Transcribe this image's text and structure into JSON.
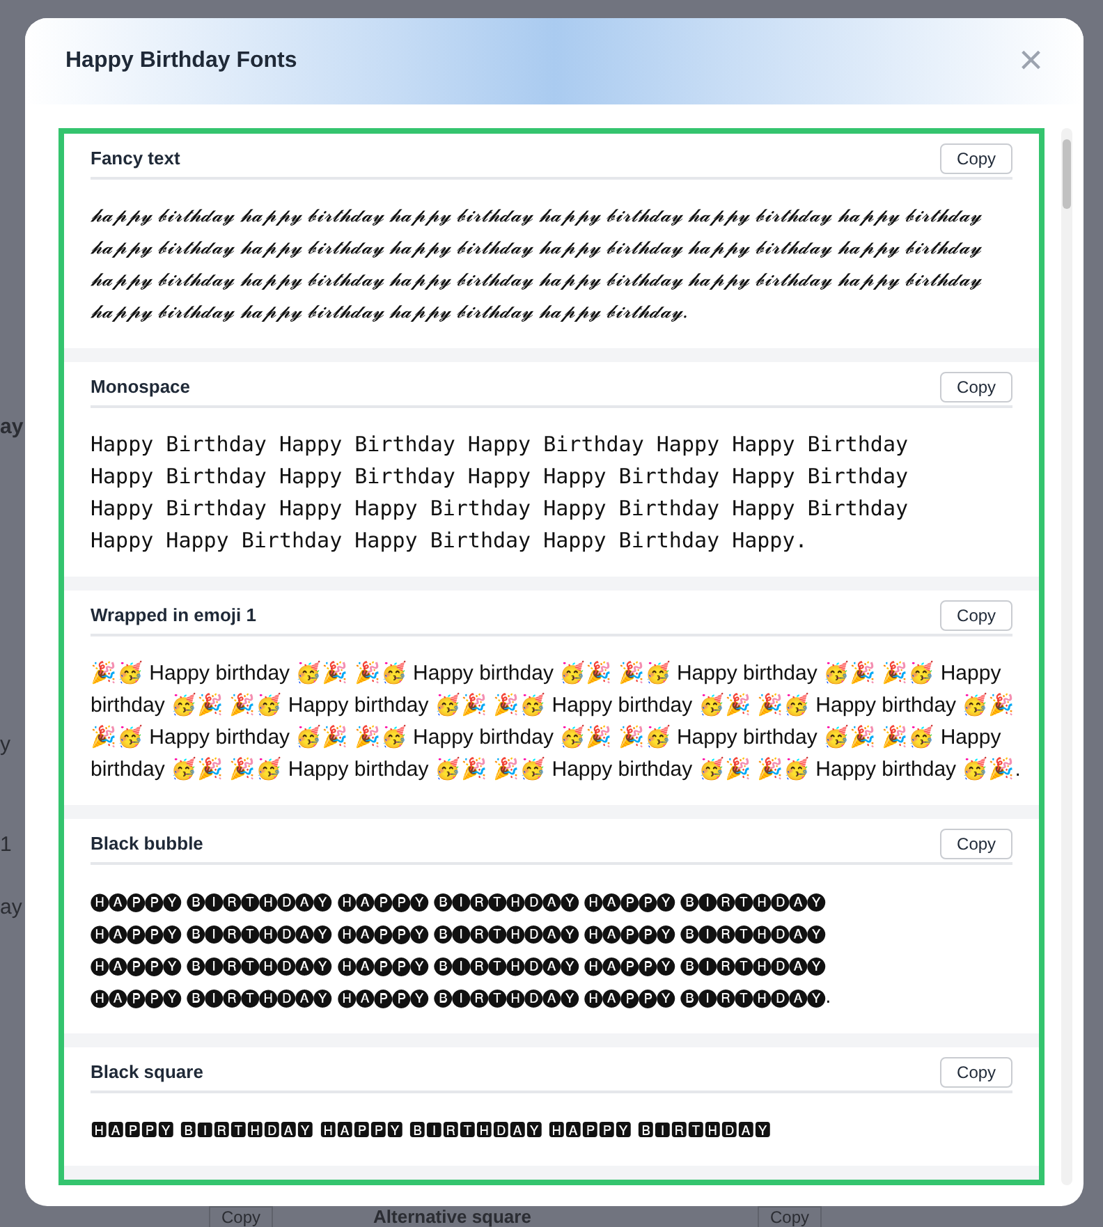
{
  "background": {
    "left_fragments": [
      {
        "text": "ay",
        "kind": "heading"
      },
      {
        "text": "y",
        "kind": "text"
      },
      {
        "text": "1",
        "kind": "text"
      },
      {
        "text": "ay",
        "kind": "text"
      }
    ],
    "bottom": [
      {
        "text": "Copy",
        "kind": "button"
      },
      {
        "text": "Alternative square",
        "kind": "heading"
      },
      {
        "text": "Copy",
        "kind": "button"
      }
    ]
  },
  "dialog": {
    "title": "Happy Birthday Fonts",
    "close": "×",
    "cards": [
      {
        "title": "Fancy text",
        "button": "Copy",
        "kind": "script",
        "lines": [
          "𝓱𝓪𝓹𝓹𝔂 𝓫𝓲𝓻𝓽𝓱𝓭𝓪𝔂 𝓱𝓪𝓹𝓹𝔂 𝓫𝓲𝓻𝓽𝓱𝓭𝓪𝔂 𝓱𝓪𝓹𝓹𝔂 𝓫𝓲𝓻𝓽𝓱𝓭𝓪𝔂 𝓱𝓪𝓹𝓹𝔂 𝓫𝓲𝓻𝓽𝓱𝓭𝓪𝔂 𝓱𝓪𝓹𝓹𝔂 𝓫𝓲𝓻𝓽𝓱𝓭𝓪𝔂 𝓱𝓪𝓹𝓹𝔂 𝓫𝓲𝓻𝓽𝓱𝓭𝓪𝔂",
          "𝓱𝓪𝓹𝓹𝔂 𝓫𝓲𝓻𝓽𝓱𝓭𝓪𝔂 𝓱𝓪𝓹𝓹𝔂 𝓫𝓲𝓻𝓽𝓱𝓭𝓪𝔂 𝓱𝓪𝓹𝓹𝔂 𝓫𝓲𝓻𝓽𝓱𝓭𝓪𝔂 𝓱𝓪𝓹𝓹𝔂 𝓫𝓲𝓻𝓽𝓱𝓭𝓪𝔂 𝓱𝓪𝓹𝓹𝔂 𝓫𝓲𝓻𝓽𝓱𝓭𝓪𝔂 𝓱𝓪𝓹𝓹𝔂 𝓫𝓲𝓻𝓽𝓱𝓭𝓪𝔂",
          "𝓱𝓪𝓹𝓹𝔂 𝓫𝓲𝓻𝓽𝓱𝓭𝓪𝔂 𝓱𝓪𝓹𝓹𝔂 𝓫𝓲𝓻𝓽𝓱𝓭𝓪𝔂 𝓱𝓪𝓹𝓹𝔂 𝓫𝓲𝓻𝓽𝓱𝓭𝓪𝔂 𝓱𝓪𝓹𝓹𝔂 𝓫𝓲𝓻𝓽𝓱𝓭𝓪𝔂 𝓱𝓪𝓹𝓹𝔂 𝓫𝓲𝓻𝓽𝓱𝓭𝓪𝔂 𝓱𝓪𝓹𝓹𝔂 𝓫𝓲𝓻𝓽𝓱𝓭𝓪𝔂",
          "𝓱𝓪𝓹𝓹𝔂 𝓫𝓲𝓻𝓽𝓱𝓭𝓪𝔂 𝓱𝓪𝓹𝓹𝔂 𝓫𝓲𝓻𝓽𝓱𝓭𝓪𝔂 𝓱𝓪𝓹𝓹𝔂 𝓫𝓲𝓻𝓽𝓱𝓭𝓪𝔂 𝓱𝓪𝓹𝓹𝔂 𝓫𝓲𝓻𝓽𝓱𝓭𝓪𝔂."
        ]
      },
      {
        "title": "Monospace",
        "button": "Copy",
        "kind": "mono",
        "lines": [
          "𝙷𝚊𝚙𝚙𝚢 𝙱𝚒𝚛𝚝𝚑𝚍𝚊𝚢 𝙷𝚊𝚙𝚙𝚢 𝙱𝚒𝚛𝚝𝚑𝚍𝚊𝚢 𝙷𝚊𝚙𝚙𝚢 𝙱𝚒𝚛𝚝𝚑𝚍𝚊𝚢 𝙷𝚊𝚙𝚙𝚢 𝙷𝚊𝚙𝚙𝚢 𝙱𝚒𝚛𝚝𝚑𝚍𝚊𝚢",
          "𝙷𝚊𝚙𝚙𝚢 𝙱𝚒𝚛𝚝𝚑𝚍𝚊𝚢 𝙷𝚊𝚙𝚙𝚢 𝙱𝚒𝚛𝚝𝚑𝚍𝚊𝚢 𝙷𝚊𝚙𝚙𝚢 𝙷𝚊𝚙𝚙𝚢 𝙱𝚒𝚛𝚝𝚑𝚍𝚊𝚢 𝙷𝚊𝚙𝚙𝚢 𝙱𝚒𝚛𝚝𝚑𝚍𝚊𝚢",
          "𝙷𝚊𝚙𝚙𝚢 𝙱𝚒𝚛𝚝𝚑𝚍𝚊𝚢 𝙷𝚊𝚙𝚙𝚢 𝙷𝚊𝚙𝚙𝚢 𝙱𝚒𝚛𝚝𝚑𝚍𝚊𝚢 𝙷𝚊𝚙𝚙𝚢 𝙱𝚒𝚛𝚝𝚑𝚍𝚊𝚢 𝙷𝚊𝚙𝚙𝚢 𝙱𝚒𝚛𝚝𝚑𝚍𝚊𝚢",
          "𝙷𝚊𝚙𝚙𝚢 𝙷𝚊𝚙𝚙𝚢 𝙱𝚒𝚛𝚝𝚑𝚍𝚊𝚢 𝙷𝚊𝚙𝚙𝚢 𝙱𝚒𝚛𝚝𝚑𝚍𝚊𝚢 𝙷𝚊𝚙𝚙𝚢 𝙱𝚒𝚛𝚝𝚑𝚍𝚊𝚢 𝙷𝚊𝚙𝚙𝚢."
        ]
      },
      {
        "title": "Wrapped in emoji 1",
        "button": "Copy",
        "kind": "plain",
        "lines": [
          "🎉🥳 Happy birthday 🥳🎉 🎉🥳 Happy birthday 🥳🎉 🎉🥳 Happy birthday 🥳🎉 🎉🥳 Happy",
          "birthday 🥳🎉 🎉🥳 Happy birthday 🥳🎉 🎉🥳 Happy birthday 🥳🎉 🎉🥳 Happy birthday 🥳🎉",
          "🎉🥳 Happy birthday 🥳🎉 🎉🥳 Happy birthday 🥳🎉 🎉🥳 Happy birthday 🥳🎉 🎉🥳 Happy",
          "birthday 🥳🎉 🎉🥳 Happy birthday 🥳🎉 🎉🥳 Happy birthday 🥳🎉 🎉🥳 Happy birthday 🥳🎉."
        ]
      },
      {
        "title": "Black bubble",
        "button": "Copy",
        "kind": "symbol",
        "lines": [
          "🅗🅐🅟🅟🅨 🅑🅘🅡🅣🅗🅓🅐🅨 🅗🅐🅟🅟🅨 🅑🅘🅡🅣🅗🅓🅐🅨 🅗🅐🅟🅟🅨 🅑🅘🅡🅣🅗🅓🅐🅨",
          "🅗🅐🅟🅟🅨 🅑🅘🅡🅣🅗🅓🅐🅨 🅗🅐🅟🅟🅨 🅑🅘🅡🅣🅗🅓🅐🅨 🅗🅐🅟🅟🅨 🅑🅘🅡🅣🅗🅓🅐🅨",
          "🅗🅐🅟🅟🅨 🅑🅘🅡🅣🅗🅓🅐🅨 🅗🅐🅟🅟🅨 🅑🅘🅡🅣🅗🅓🅐🅨 🅗🅐🅟🅟🅨 🅑🅘🅡🅣🅗🅓🅐🅨",
          "🅗🅐🅟🅟🅨 🅑🅘🅡🅣🅗🅓🅐🅨 🅗🅐🅟🅟🅨 🅑🅘🅡🅣🅗🅓🅐🅨 🅗🅐🅟🅟🅨 🅑🅘🅡🅣🅗🅓🅐🅨."
        ]
      },
      {
        "title": "Black square",
        "button": "Copy",
        "kind": "symbol",
        "lines": [
          "🅷🅰🅿🅿🆈 🅱🅸🆁🆃🅷🅳🅰🆈 🅷🅰🅿🅿🆈 🅱🅸🆁🆃🅷🅳🅰🆈 🅷🅰🅿🅿🆈 🅱🅸🆁🆃🅷🅳🅰🆈"
        ]
      }
    ]
  }
}
